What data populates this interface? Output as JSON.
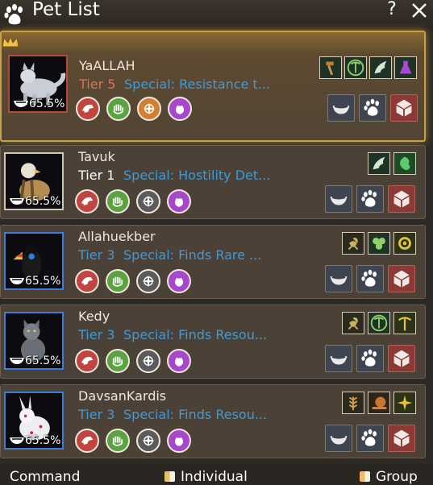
{
  "window": {
    "title": "Pet List",
    "help_label": "?"
  },
  "pets": [
    {
      "name": "YaALLAH",
      "tier": "Tier 5",
      "special": "Special: Resistance t...",
      "hunger": "65.5%",
      "skills": [
        "hammer-skill-icon",
        "pickaxe-ring-skill-icon",
        "wings-skill-icon",
        "flask-skill-icon"
      ]
    },
    {
      "name": "Tavuk",
      "tier": "Tier 1",
      "special": "Special: Hostility Det...",
      "hunger": "65.5%",
      "skills": [
        "wings-skill-icon",
        "clover-leaf-skill-icon"
      ]
    },
    {
      "name": "Allahuekber",
      "tier": "Tier 3",
      "special": "Special: Finds Rare ...",
      "hunger": "65.5%",
      "skills": [
        "scorpion-skill-icon",
        "clover-skill-icon",
        "gear-skill-icon"
      ]
    },
    {
      "name": "Kedy",
      "tier": "Tier 3",
      "special": "Special: Finds Resou...",
      "hunger": "65.5%",
      "skills": [
        "scorpion-skill-icon",
        "pickaxe-ring-skill-icon",
        "pickaxe-skill-icon"
      ]
    },
    {
      "name": "DavsanKardis",
      "tier": "Tier 3",
      "special": "Special: Finds Resou...",
      "hunger": "65.5%",
      "skills": [
        "wheat-skill-icon",
        "snail-skill-icon",
        "sparkle-skill-icon"
      ]
    }
  ],
  "bottom": {
    "command_label": "Command",
    "individual_label": "Individual",
    "group_label": "Group"
  },
  "colors": {
    "selected_border": "#c8a04a",
    "tier5": "#d9715a",
    "tier3": "#3e9ad8",
    "special": "#3e9ad8"
  }
}
